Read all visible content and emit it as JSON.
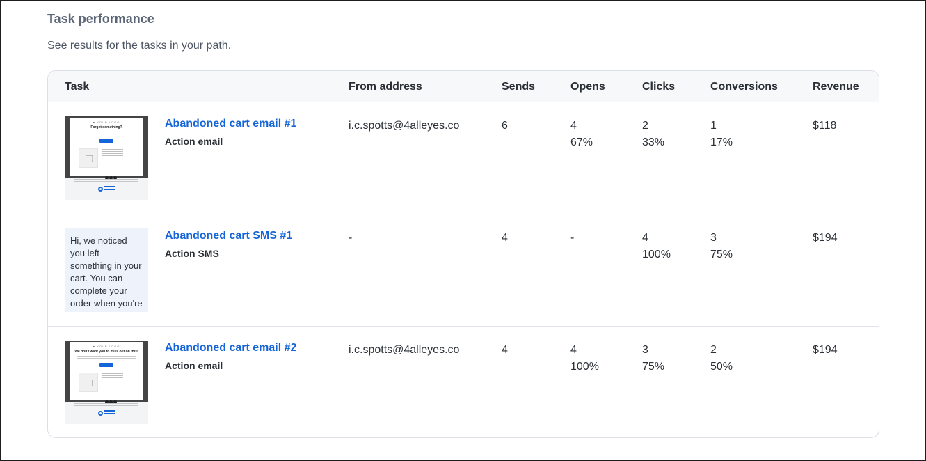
{
  "section": {
    "title": "Task performance",
    "subtitle": "See results for the tasks in your path."
  },
  "table": {
    "headers": {
      "task": "Task",
      "from": "From address",
      "sends": "Sends",
      "opens": "Opens",
      "clicks": "Clicks",
      "conversions": "Conversions",
      "revenue": "Revenue"
    },
    "rows": [
      {
        "name": "Abandoned cart email #1",
        "type": "Action email",
        "thumb_kind": "email",
        "email_headline": "Forget something?",
        "from": "i.c.spotts@4alleyes.co",
        "sends": "6",
        "opens": "4",
        "opens_pct": "67%",
        "clicks": "2",
        "clicks_pct": "33%",
        "conversions": "1",
        "conversions_pct": "17%",
        "revenue": "$118"
      },
      {
        "name": "Abandoned cart SMS #1",
        "type": "Action SMS",
        "thumb_kind": "sms",
        "sms_text": "Hi, we noticed you left something in your cart. You can complete your order when you're",
        "from": "-",
        "sends": "4",
        "opens": "-",
        "opens_pct": "",
        "clicks": "4",
        "clicks_pct": "100%",
        "conversions": "3",
        "conversions_pct": "75%",
        "revenue": "$194"
      },
      {
        "name": "Abandoned cart email #2",
        "type": "Action email",
        "thumb_kind": "email",
        "email_headline": "We don't want you to miss out on this!",
        "from": "i.c.spotts@4alleyes.co",
        "sends": "4",
        "opens": "4",
        "opens_pct": "100%",
        "clicks": "3",
        "clicks_pct": "75%",
        "conversions": "2",
        "conversions_pct": "50%",
        "revenue": "$194"
      }
    ]
  },
  "colors": {
    "link": "#1565d8",
    "header_bg": "#f7f8fa",
    "border": "#dcdfe5",
    "sms_bg": "#eef2fa"
  }
}
